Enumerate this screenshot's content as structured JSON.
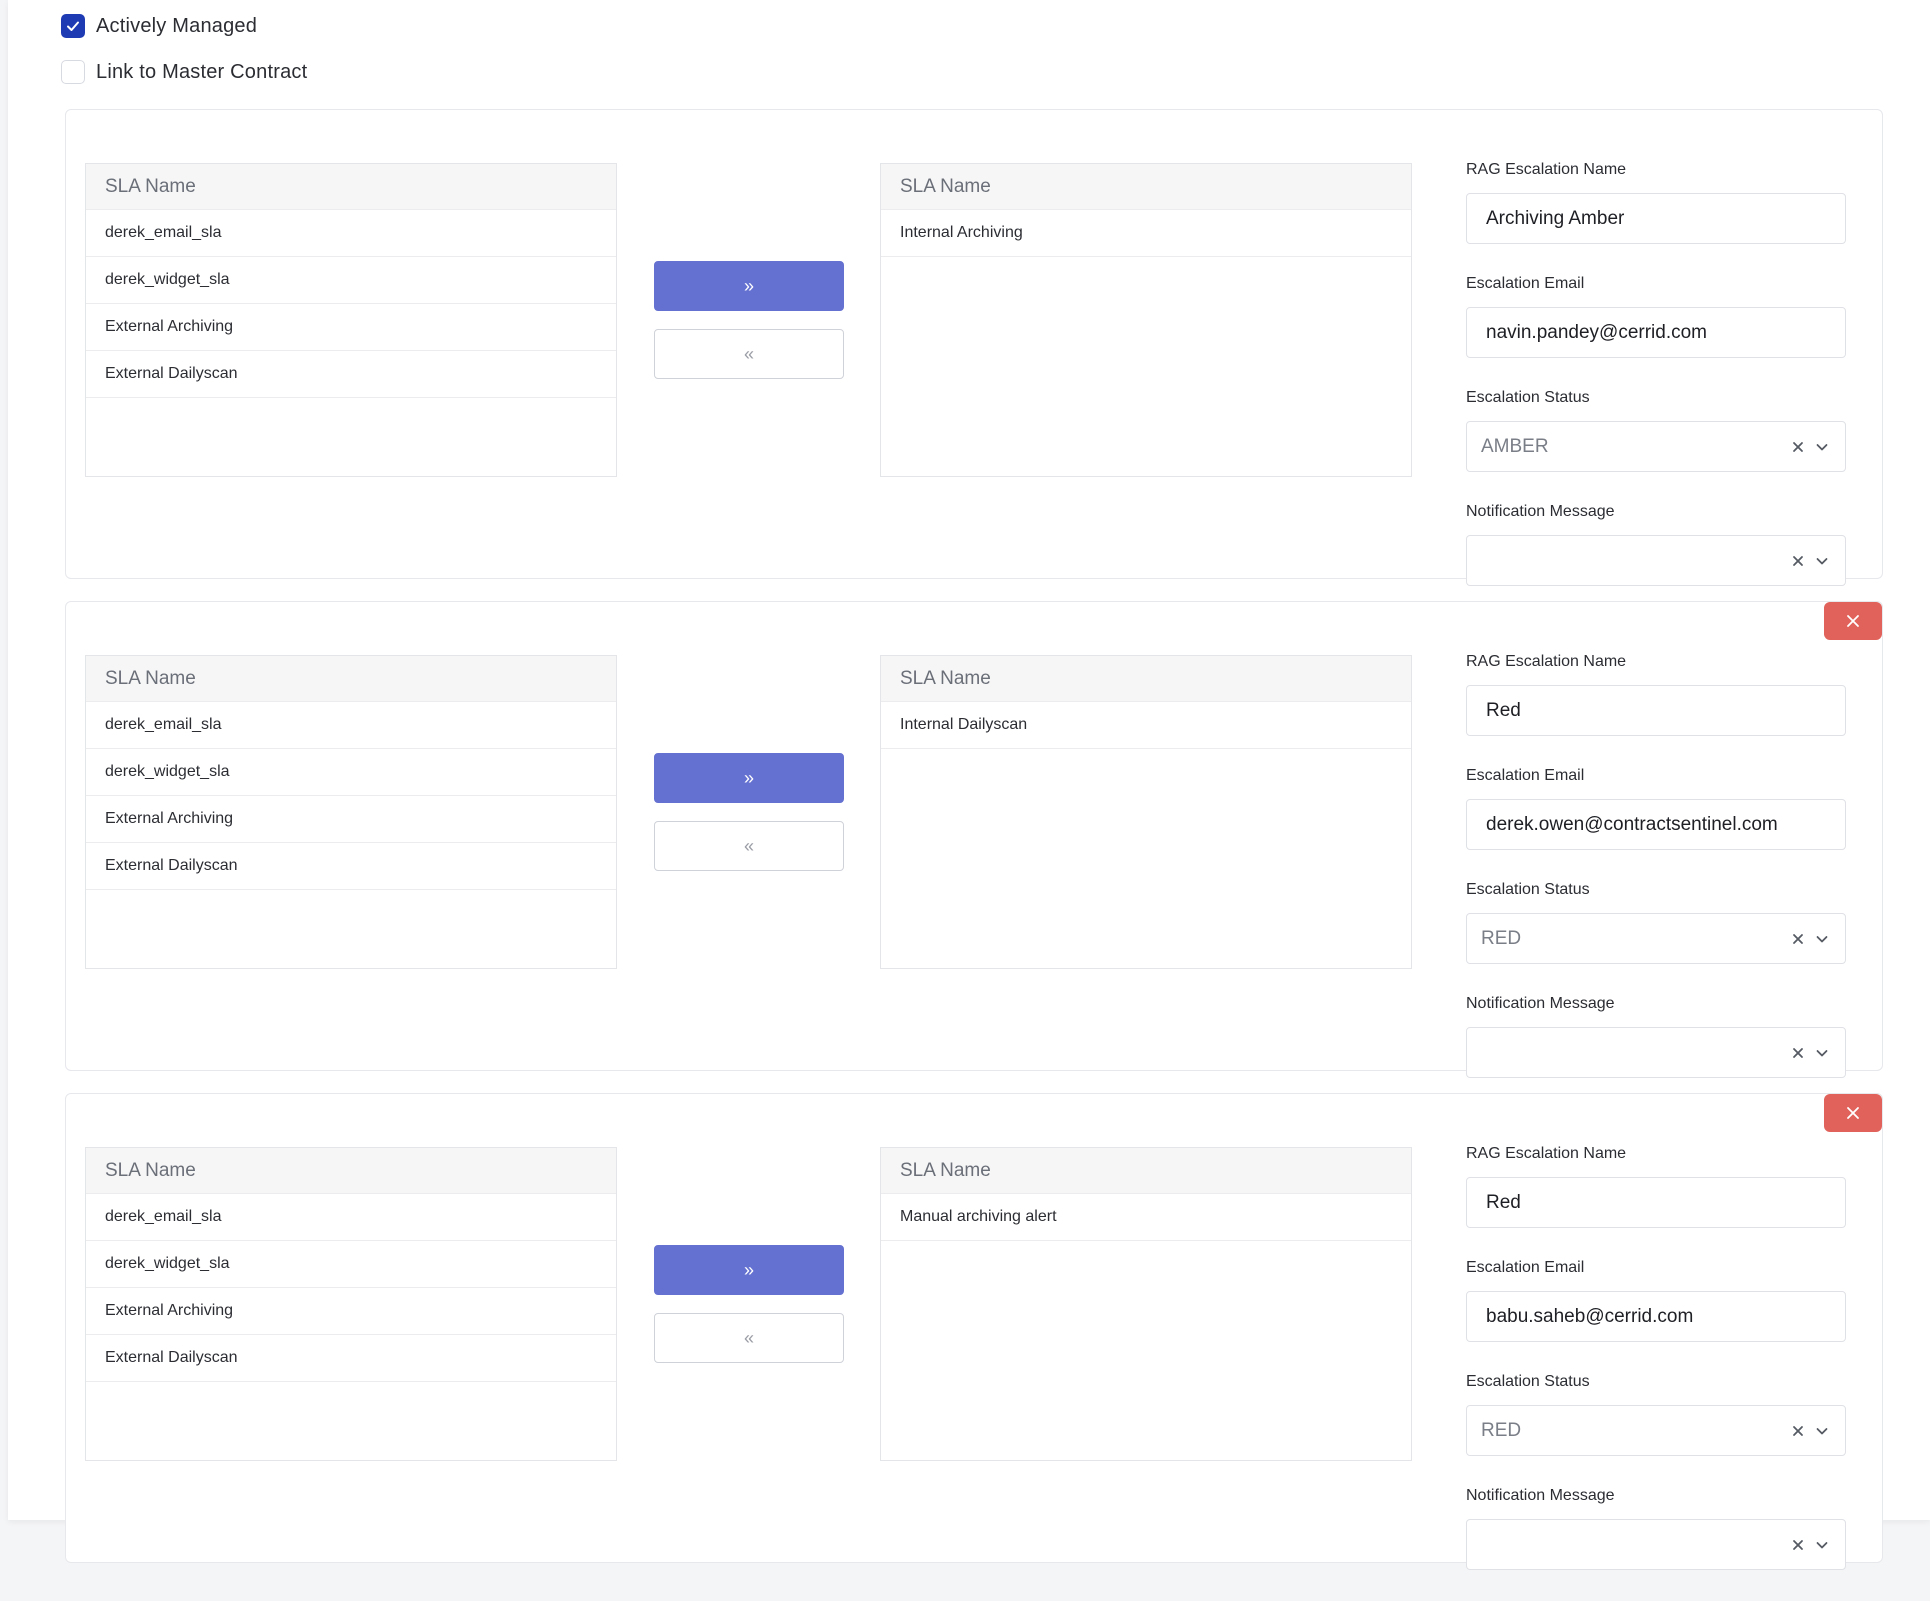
{
  "options": {
    "actively_managed_label": "Actively Managed",
    "actively_managed_checked": true,
    "link_master_label": "Link to Master Contract",
    "link_master_checked": false
  },
  "labels": {
    "sla_header": "SLA Name",
    "move_right": "»",
    "move_left": "«",
    "rag_name": "RAG Escalation Name",
    "email": "Escalation Email",
    "status": "Escalation Status",
    "notification": "Notification Message"
  },
  "colors": {
    "primary": "#6571d0",
    "checkbox": "#1f3bb3",
    "danger": "#e0625b"
  },
  "icons": {
    "remove": "close-icon",
    "clear": "clear-icon",
    "dropdown": "chevron-down-icon",
    "check": "check-icon"
  },
  "escalations": [
    {
      "available": [
        "derek_email_sla",
        "derek_widget_sla",
        "External Archiving",
        "External Dailyscan"
      ],
      "selected": [
        "Internal Archiving"
      ],
      "rag_name": "Archiving Amber",
      "email": "navin.pandey@cerrid.com",
      "status": "AMBER",
      "notification": ""
    },
    {
      "available": [
        "derek_email_sla",
        "derek_widget_sla",
        "External Archiving",
        "External Dailyscan"
      ],
      "selected": [
        "Internal Dailyscan"
      ],
      "rag_name": "Red",
      "email": "derek.owen@contractsentinel.com",
      "status": "RED",
      "notification": ""
    },
    {
      "available": [
        "derek_email_sla",
        "derek_widget_sla",
        "External Archiving",
        "External Dailyscan"
      ],
      "selected": [
        "Manual archiving alert"
      ],
      "rag_name": "Red",
      "email": "babu.saheb@cerrid.com",
      "status": "RED",
      "notification": ""
    }
  ]
}
